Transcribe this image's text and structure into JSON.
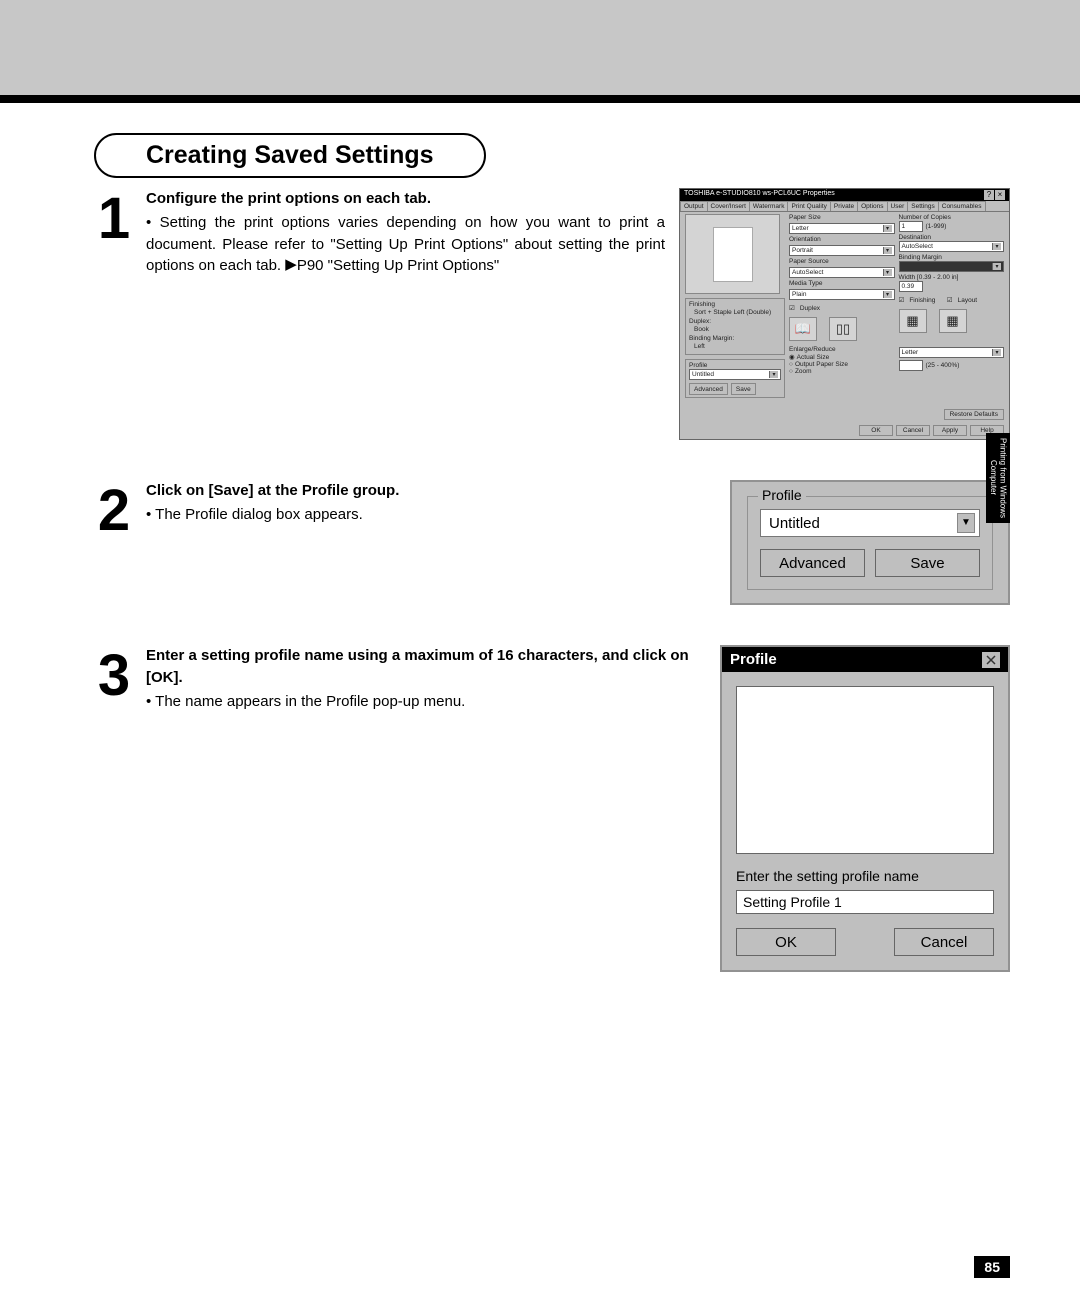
{
  "header": {
    "title": "Creating Saved Settings"
  },
  "steps": {
    "s1": {
      "num": "1",
      "heading": "Configure the print options on each tab.",
      "body": "Setting the print options varies depending on how you want to print a document.  Please refer to \"Setting Up Print Options\" about setting the print options on each tab.  ",
      "ref": "P90 \"Setting Up Print Options\""
    },
    "s2": {
      "num": "2",
      "heading": "Click on [Save] at the Profile group.",
      "body": "The Profile dialog box appears."
    },
    "s3": {
      "num": "3",
      "heading": "Enter a setting profile name using a maximum of 16 characters, and click on [OK].",
      "body": "The name appears in the Profile pop-up menu."
    }
  },
  "fig1": {
    "title": "TOSHIBA e-STUDIO810 ws-PCL6UC Properties",
    "tabs": [
      "Output",
      "Cover/Insert",
      "Watermark",
      "Print Quality",
      "Private",
      "Options",
      "User",
      "Settings",
      "Consumables"
    ],
    "labels": {
      "paperSize": "Paper Size",
      "paperSizeVal": "Letter",
      "orientation": "Orientation",
      "orientationVal": "Portrait",
      "paperSource": "Paper Source",
      "paperSourceVal": "AutoSelect",
      "mediaType": "Media Type",
      "mediaTypeVal": "Plain",
      "copies": "Number of Copies",
      "copiesVal": "1",
      "copiesRange": "(1-999)",
      "destination": "Destination",
      "destinationVal": "AutoSelect",
      "bindingMargin": "Binding Margin",
      "width": "Width [0.39 - 2.00 in]",
      "widthVal": "0.39",
      "duplex": "Duplex",
      "finishing_chk": "Finishing",
      "layout": "Layout"
    },
    "finishing": {
      "heading": "Finishing",
      "line1": "Sort + Staple Left (Double)",
      "duplex": "Duplex:",
      "book": "Book",
      "binding": "Binding Margin:",
      "left": "Left"
    },
    "profile": {
      "heading": "Profile",
      "value": "Untitled",
      "advanced": "Advanced",
      "save": "Save"
    },
    "enlarge": {
      "heading": "Enlarge/Reduce",
      "actual": "Actual Size",
      "output": "Output Paper Size",
      "zoom": "Zoom",
      "outVal": "Letter",
      "range": "(25 - 400%)"
    },
    "footer": {
      "restore": "Restore Defaults",
      "ok": "OK",
      "cancel": "Cancel",
      "apply": "Apply",
      "help": "Help"
    }
  },
  "fig2": {
    "legend": "Profile",
    "value": "Untitled",
    "advanced": "Advanced",
    "save": "Save"
  },
  "fig3": {
    "title": "Profile",
    "label": "Enter the setting profile name",
    "value": "Setting Profile 1",
    "ok": "OK",
    "cancel": "Cancel"
  },
  "sideTab": "Printing from\nWindows Computer",
  "pageNum": "85"
}
